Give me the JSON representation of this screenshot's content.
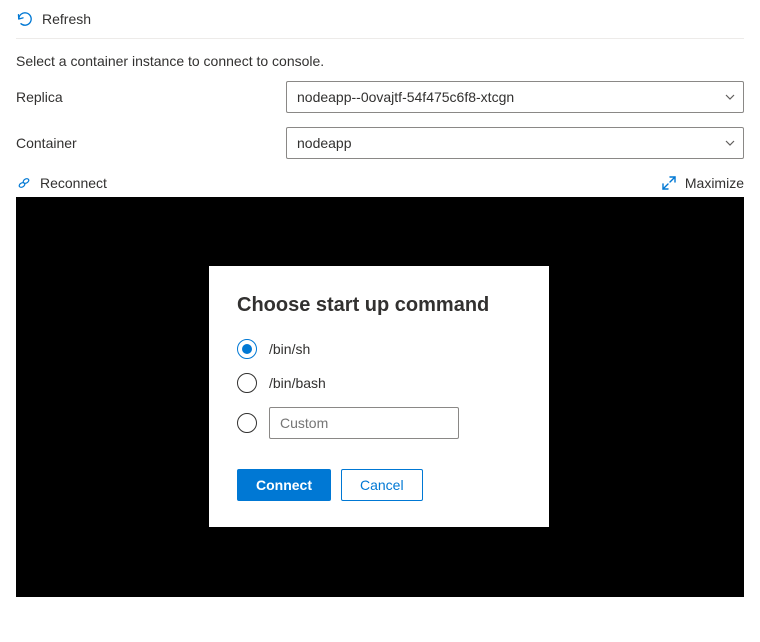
{
  "toolbar": {
    "refresh_label": "Refresh"
  },
  "intro_text": "Select a container instance to connect to console.",
  "form": {
    "replica_label": "Replica",
    "replica_value": "nodeapp--0ovajtf-54f475c6f8-xtcgn",
    "container_label": "Container",
    "container_value": "nodeapp"
  },
  "actions": {
    "reconnect_label": "Reconnect",
    "maximize_label": "Maximize"
  },
  "dialog": {
    "title": "Choose start up command",
    "options": {
      "sh": "/bin/sh",
      "bash": "/bin/bash",
      "custom_placeholder": "Custom"
    },
    "selected": "sh",
    "connect_label": "Connect",
    "cancel_label": "Cancel"
  }
}
